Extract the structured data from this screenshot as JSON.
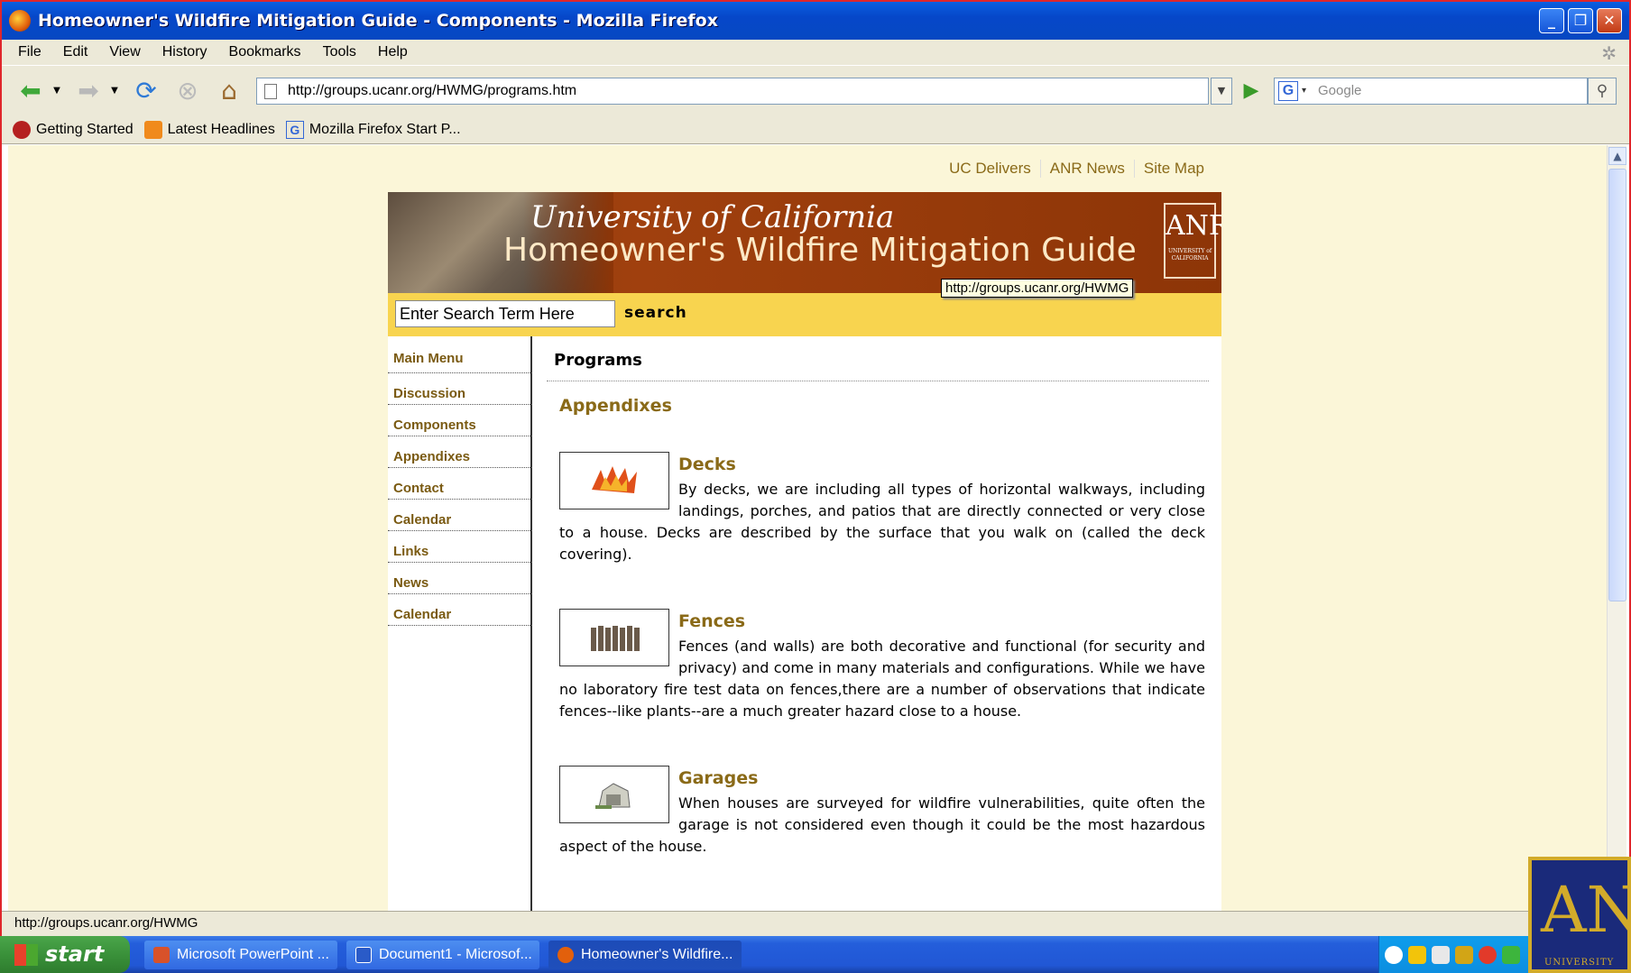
{
  "window": {
    "title": "Homeowner's Wildfire Mitigation Guide - Components - Mozilla Firefox"
  },
  "menu": [
    "File",
    "Edit",
    "View",
    "History",
    "Bookmarks",
    "Tools",
    "Help"
  ],
  "toolbar": {
    "url": "http://groups.ucanr.org/HWMG/programs.htm",
    "search_placeholder": "Google"
  },
  "bookmarks": [
    "Getting Started",
    "Latest Headlines",
    "Mozilla Firefox Start P..."
  ],
  "page": {
    "top_links": [
      "UC Delivers",
      "ANR News",
      "Site Map"
    ],
    "banner": {
      "line1": "University of California",
      "line2": "Homeowner's Wildfire Mitigation Guide",
      "logo": "ANR",
      "logo_sub": "UNIVERSITY of CALIFORNIA"
    },
    "search": {
      "placeholder": "Enter Search Term Here",
      "button": "search"
    },
    "tooltip": "http://groups.ucanr.org/HWMG",
    "nav": [
      "Main Menu",
      "Discussion",
      "Components",
      "Appendixes",
      "Contact",
      "Calendar",
      "Links",
      "News",
      "Calendar"
    ],
    "title": "Programs",
    "section": "Appendixes",
    "entries": [
      {
        "title": "Decks",
        "icon": "flame-icon",
        "text": "By decks, we are including all types of horizontal walkways, including landings, porches, and patios that are directly connected or very close to a house. Decks are described by the surface that you walk on (called the deck covering)."
      },
      {
        "title": "Fences",
        "icon": "fence-icon",
        "text": "Fences (and walls) are both decorative and functional (for security and privacy) and come in many materials and configurations. While we have no laboratory fire test data on fences,there are a number of observations that indicate fences--like plants--are a much greater hazard close to a house."
      },
      {
        "title": "Garages",
        "icon": "garage-icon",
        "text": "When houses are surveyed for wildfire vulnerabilities, quite often the garage is not considered even though it could be the most hazardous aspect of the house."
      }
    ]
  },
  "status": "http://groups.ucanr.org/HWMG",
  "taskbar": {
    "start": "start",
    "tasks": [
      "Microsoft PowerPoint ...",
      "Document1 - Microsof...",
      "Homeowner's Wildfire..."
    ]
  },
  "corner_logo": {
    "text": "ANR",
    "sub": "UNIVERSITY"
  },
  "colors": {
    "accent_gold": "#8a6a18",
    "search_bar": "#f8d44f",
    "page_bg": "#fbf6d8",
    "banner": "#8d3507"
  }
}
